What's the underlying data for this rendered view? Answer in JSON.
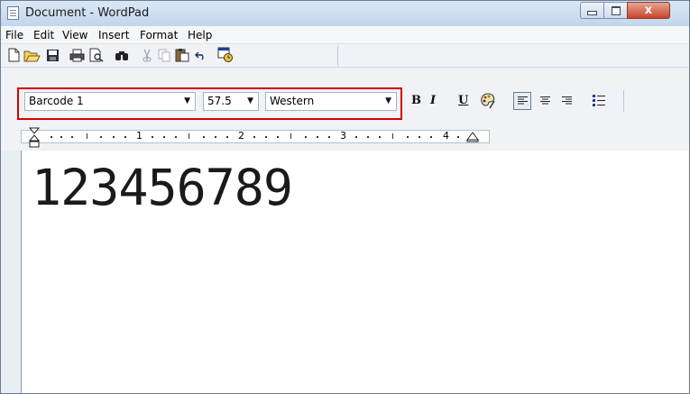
{
  "window": {
    "title": "Document - WordPad",
    "caption_buttons": {
      "minimize": "minimize-icon",
      "maximize": "maximize-icon",
      "close": "close-icon",
      "close_glyph": "x"
    }
  },
  "menu": [
    "File",
    "Edit",
    "View",
    "Insert",
    "Format",
    "Help"
  ],
  "toolbar": {
    "icons": [
      "new-document-icon",
      "open-folder-icon",
      "save-disk-icon",
      "print-icon",
      "print-preview-icon",
      "find-binoculars-icon",
      "cut-scissors-icon",
      "copy-icon",
      "paste-icon",
      "undo-icon",
      "date-time-icon"
    ]
  },
  "format_bar": {
    "font": "Barcode 1",
    "size": "57.5",
    "script": "Western",
    "bold": "B",
    "italic": "I",
    "underline": "U",
    "color_icon": "color-palette-icon",
    "alignment_selected": "left",
    "highlight_color": "#d40000"
  },
  "ruler": {
    "numbers": [
      "1",
      "2",
      "3",
      "4"
    ]
  },
  "document": {
    "text": "123456789"
  }
}
